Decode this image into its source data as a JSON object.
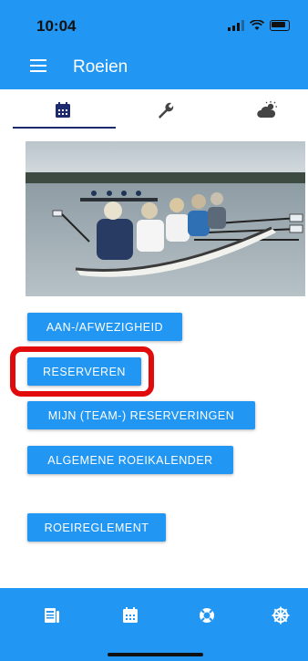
{
  "status": {
    "time": "10:04"
  },
  "app": {
    "title": "Roeien"
  },
  "tabs": [
    {
      "icon": "calendar-icon",
      "active": true
    },
    {
      "icon": "wrench-icon",
      "active": false
    },
    {
      "icon": "weather-icon",
      "active": false
    }
  ],
  "buttons": {
    "attendance": "AAN-/AFWEZIGHEID",
    "reserve": "RESERVEREN",
    "my_reservations": "MIJN (TEAM-) RESERVERINGEN",
    "calendar": "ALGEMENE ROEIKALENDER",
    "rules": "ROEIREGLEMENT"
  },
  "bottom_nav": [
    {
      "icon": "news-icon"
    },
    {
      "icon": "calendar-icon"
    },
    {
      "icon": "lifebuoy-icon"
    },
    {
      "icon": "helm-icon"
    }
  ],
  "colors": {
    "primary": "#2196f3",
    "highlight": "#e10b0b",
    "tab_indicator": "#1e2a6e"
  }
}
